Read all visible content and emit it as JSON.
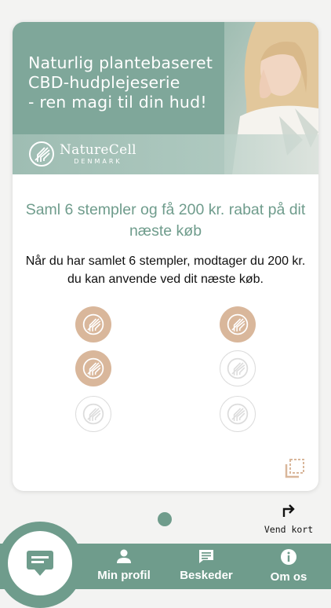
{
  "banner": {
    "tagline": "Naturlig plantebaseret\nCBD-hudplejeserie\n- ren magi til din hud!",
    "brand_name": "NatureCell",
    "brand_sub": "DENMARK"
  },
  "card": {
    "headline": "Saml 6 stempler og få 200 kr. rabat på dit næste køb",
    "description": "Når du har samlet 6 stempler,  modtager du 200 kr. du kan anvende ved dit næste køb.",
    "stamps_total": 6,
    "stamps_collected": 3
  },
  "flip": {
    "label": "Vend kort"
  },
  "nav": {
    "items": [
      {
        "label": "Min profil",
        "icon": "person-icon"
      },
      {
        "label": "Beskeder",
        "icon": "message-icon"
      },
      {
        "label": "Om os",
        "icon": "info-icon"
      }
    ],
    "center_icon": "stamp-card-icon"
  },
  "colors": {
    "accent": "#6f9c8c",
    "stamp_filled": "#d9b79b",
    "stamp_empty_border": "#dcdcdc"
  }
}
